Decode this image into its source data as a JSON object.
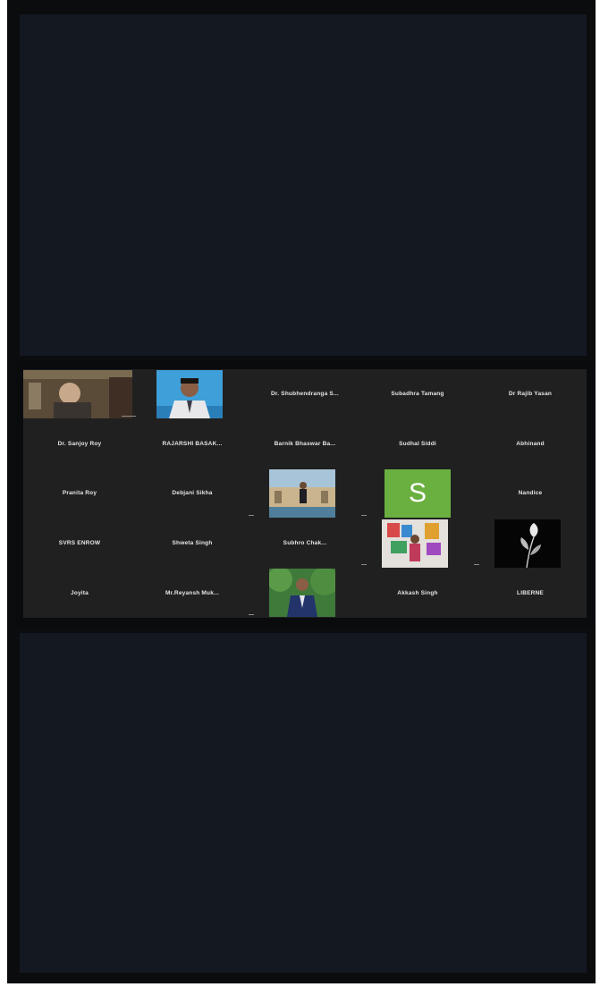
{
  "participants": [
    {
      "name": ""
    },
    {
      "name": ""
    },
    {
      "name": "Dr. Shubhendranga S..."
    },
    {
      "name": "Subadhra Tamang"
    },
    {
      "name": "Dr Rajib Yasan"
    },
    {
      "name": "Dr. Sanjoy Roy"
    },
    {
      "name": "RAJARSHI BASAK..."
    },
    {
      "name": "Barnik Bhaswar Ba..."
    },
    {
      "name": "Sudhal Siddi"
    },
    {
      "name": "Abhinand"
    },
    {
      "name": "Pranita Roy"
    },
    {
      "name": "Debjani Sikha"
    },
    {
      "name": ""
    },
    {
      "name": ""
    },
    {
      "name": "Nandice"
    },
    {
      "name": "SVRS ENROW"
    },
    {
      "name": "Shweta Singh"
    },
    {
      "name": "Subhro Chak..."
    },
    {
      "name": ""
    },
    {
      "name": ""
    },
    {
      "name": "Joyita"
    },
    {
      "name": "Mr.Reyansh Muk..."
    },
    {
      "name": ""
    },
    {
      "name": "Akkash Singh"
    },
    {
      "name": "LIBERNE"
    }
  ],
  "avatar_letter": "S",
  "colors": {
    "background": "#0b0c0e",
    "panel": "#131821",
    "grid": "#202020",
    "avatar_green": "#6ab040"
  }
}
